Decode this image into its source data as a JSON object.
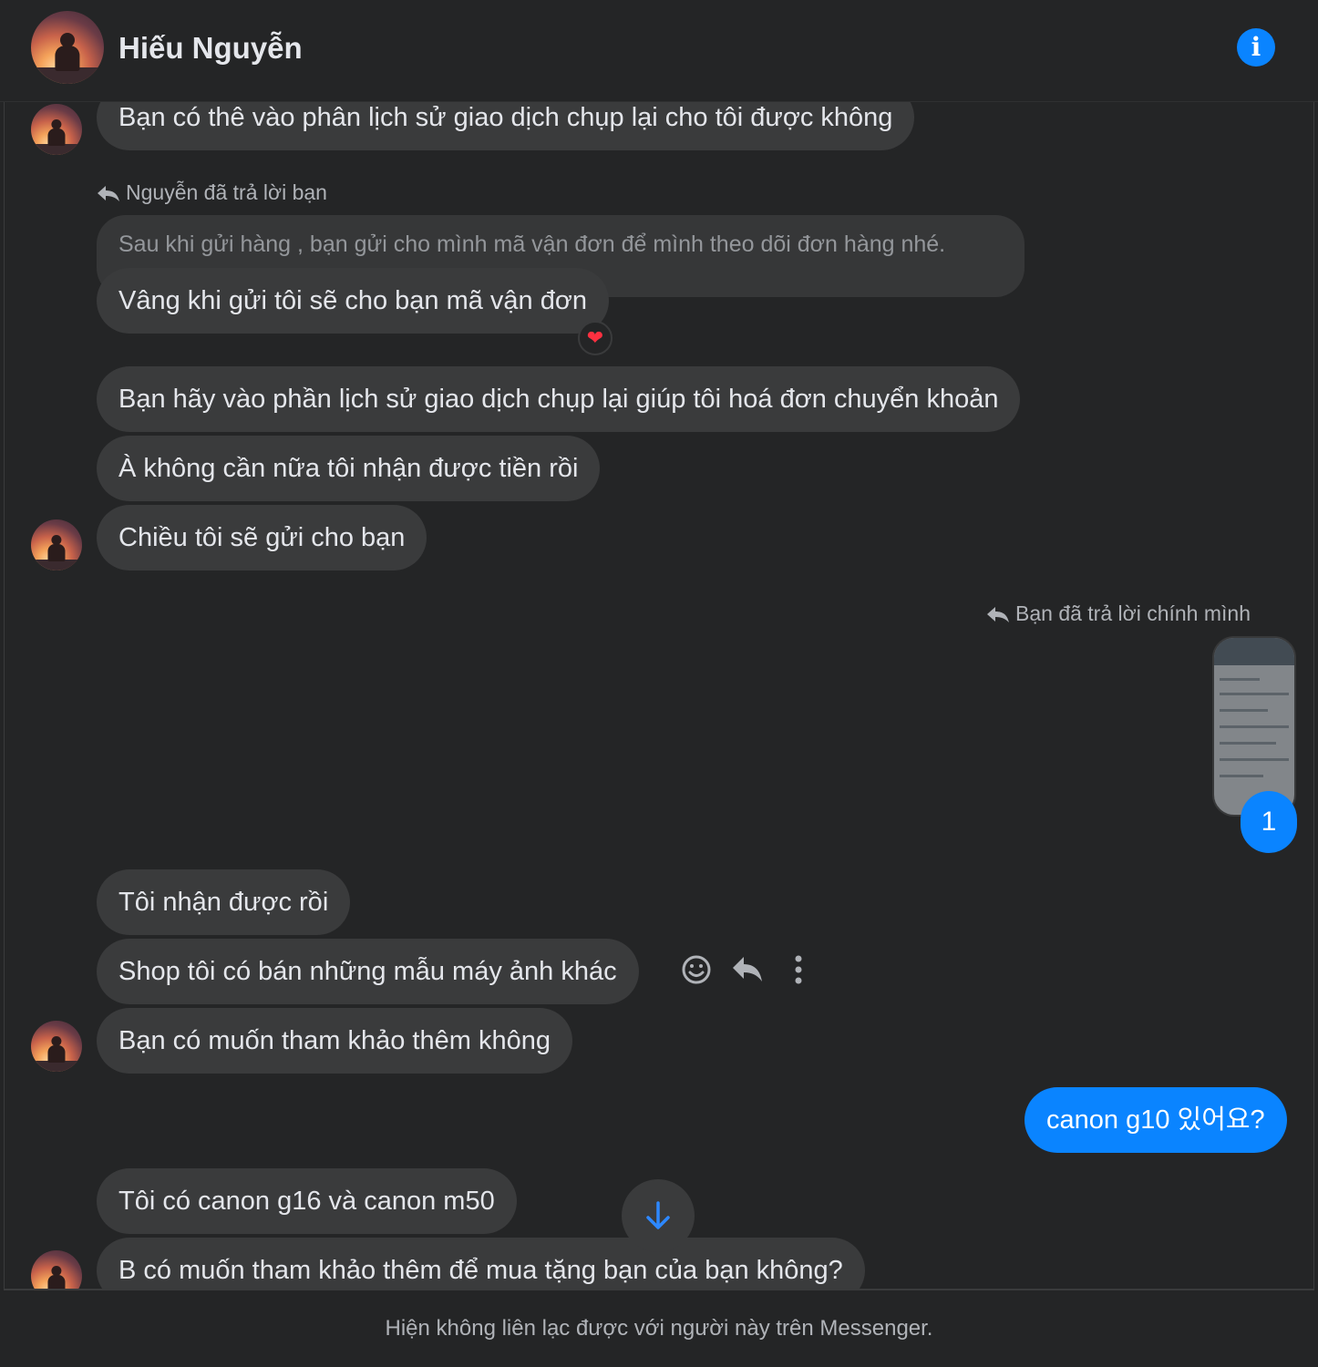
{
  "header": {
    "contact_name": "Hiếu Nguyễn",
    "info_icon": "info-icon"
  },
  "messages": {
    "m1": "Bạn có thê vào phân lịch sử giao dịch chụp lại cho tôi được không",
    "reply_label_1": "Nguyễn đã trả lời bạn",
    "quoted_1": "Sau khi gửi hàng , bạn gửi cho mình mã vận đơn để mình theo dõi đơn hàng nhé.",
    "m2": "Vâng khi gửi tôi sẽ cho bạn mã vận đơn",
    "m2_reaction": "❤",
    "m3": "Bạn hãy vào phần lịch sử giao dịch chụp lại giúp tôi hoá đơn chuyển khoản",
    "m4": "À không cần nữa tôi nhận được tiền rồi",
    "m5": "Chiều tôi sẽ gửi cho bạn",
    "reply_label_2": "Bạn đã trả lời chính mình",
    "image_count": "1",
    "m6": "Tôi nhận được rồi",
    "m7": "Shop tôi có bán những mẫu máy ảnh khác",
    "m8": "Bạn có muốn tham khảo thêm không",
    "m9_mine": "canon g10 있어요?",
    "m10": "Tôi có canon g16 và canon m50",
    "m11": "B có muốn tham khảo thêm để mua tặng bạn của bạn không?"
  },
  "message_actions": [
    "smile-icon",
    "reply-icon",
    "more-icon"
  ],
  "footer": {
    "notice": "Hiện không liên lạc được với người này trên Messenger."
  },
  "colors": {
    "background": "#242526",
    "bubble_theirs": "#3a3b3c",
    "bubble_mine": "#0a84ff",
    "accent": "#0a84ff",
    "reaction_heart": "#ff3040"
  }
}
